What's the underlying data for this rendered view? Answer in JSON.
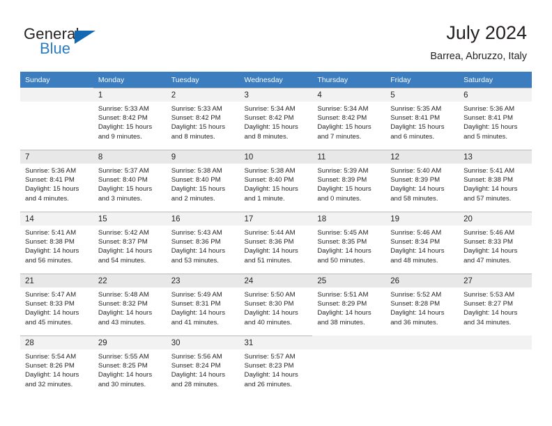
{
  "brand": {
    "name_top": "General",
    "name_bottom": "Blue",
    "triangle_icon": "triangle-icon",
    "accent_color": "#1268b3",
    "blue_text_color": "#2b7cc4"
  },
  "header": {
    "title": "July 2024",
    "subtitle": "Barrea, Abruzzo, Italy"
  },
  "theme": {
    "header_row_bg": "#3b7dbf",
    "header_row_text": "#ffffff",
    "daynum_bg": "#f2f2f2",
    "daynum_bg_alt": "#e8e8e8",
    "border_color": "#b9b9b9",
    "text_color": "#231f20"
  },
  "weekdays": [
    "Sunday",
    "Monday",
    "Tuesday",
    "Wednesday",
    "Thursday",
    "Friday",
    "Saturday"
  ],
  "weeks": [
    [
      {
        "day": "",
        "sunrise": "",
        "sunset": "",
        "daylight1": "",
        "daylight2": ""
      },
      {
        "day": "1",
        "sunrise": "Sunrise: 5:33 AM",
        "sunset": "Sunset: 8:42 PM",
        "daylight1": "Daylight: 15 hours",
        "daylight2": "and 9 minutes."
      },
      {
        "day": "2",
        "sunrise": "Sunrise: 5:33 AM",
        "sunset": "Sunset: 8:42 PM",
        "daylight1": "Daylight: 15 hours",
        "daylight2": "and 8 minutes."
      },
      {
        "day": "3",
        "sunrise": "Sunrise: 5:34 AM",
        "sunset": "Sunset: 8:42 PM",
        "daylight1": "Daylight: 15 hours",
        "daylight2": "and 8 minutes."
      },
      {
        "day": "4",
        "sunrise": "Sunrise: 5:34 AM",
        "sunset": "Sunset: 8:42 PM",
        "daylight1": "Daylight: 15 hours",
        "daylight2": "and 7 minutes."
      },
      {
        "day": "5",
        "sunrise": "Sunrise: 5:35 AM",
        "sunset": "Sunset: 8:41 PM",
        "daylight1": "Daylight: 15 hours",
        "daylight2": "and 6 minutes."
      },
      {
        "day": "6",
        "sunrise": "Sunrise: 5:36 AM",
        "sunset": "Sunset: 8:41 PM",
        "daylight1": "Daylight: 15 hours",
        "daylight2": "and 5 minutes."
      }
    ],
    [
      {
        "day": "7",
        "sunrise": "Sunrise: 5:36 AM",
        "sunset": "Sunset: 8:41 PM",
        "daylight1": "Daylight: 15 hours",
        "daylight2": "and 4 minutes."
      },
      {
        "day": "8",
        "sunrise": "Sunrise: 5:37 AM",
        "sunset": "Sunset: 8:40 PM",
        "daylight1": "Daylight: 15 hours",
        "daylight2": "and 3 minutes."
      },
      {
        "day": "9",
        "sunrise": "Sunrise: 5:38 AM",
        "sunset": "Sunset: 8:40 PM",
        "daylight1": "Daylight: 15 hours",
        "daylight2": "and 2 minutes."
      },
      {
        "day": "10",
        "sunrise": "Sunrise: 5:38 AM",
        "sunset": "Sunset: 8:40 PM",
        "daylight1": "Daylight: 15 hours",
        "daylight2": "and 1 minute."
      },
      {
        "day": "11",
        "sunrise": "Sunrise: 5:39 AM",
        "sunset": "Sunset: 8:39 PM",
        "daylight1": "Daylight: 15 hours",
        "daylight2": "and 0 minutes."
      },
      {
        "day": "12",
        "sunrise": "Sunrise: 5:40 AM",
        "sunset": "Sunset: 8:39 PM",
        "daylight1": "Daylight: 14 hours",
        "daylight2": "and 58 minutes."
      },
      {
        "day": "13",
        "sunrise": "Sunrise: 5:41 AM",
        "sunset": "Sunset: 8:38 PM",
        "daylight1": "Daylight: 14 hours",
        "daylight2": "and 57 minutes."
      }
    ],
    [
      {
        "day": "14",
        "sunrise": "Sunrise: 5:41 AM",
        "sunset": "Sunset: 8:38 PM",
        "daylight1": "Daylight: 14 hours",
        "daylight2": "and 56 minutes."
      },
      {
        "day": "15",
        "sunrise": "Sunrise: 5:42 AM",
        "sunset": "Sunset: 8:37 PM",
        "daylight1": "Daylight: 14 hours",
        "daylight2": "and 54 minutes."
      },
      {
        "day": "16",
        "sunrise": "Sunrise: 5:43 AM",
        "sunset": "Sunset: 8:36 PM",
        "daylight1": "Daylight: 14 hours",
        "daylight2": "and 53 minutes."
      },
      {
        "day": "17",
        "sunrise": "Sunrise: 5:44 AM",
        "sunset": "Sunset: 8:36 PM",
        "daylight1": "Daylight: 14 hours",
        "daylight2": "and 51 minutes."
      },
      {
        "day": "18",
        "sunrise": "Sunrise: 5:45 AM",
        "sunset": "Sunset: 8:35 PM",
        "daylight1": "Daylight: 14 hours",
        "daylight2": "and 50 minutes."
      },
      {
        "day": "19",
        "sunrise": "Sunrise: 5:46 AM",
        "sunset": "Sunset: 8:34 PM",
        "daylight1": "Daylight: 14 hours",
        "daylight2": "and 48 minutes."
      },
      {
        "day": "20",
        "sunrise": "Sunrise: 5:46 AM",
        "sunset": "Sunset: 8:33 PM",
        "daylight1": "Daylight: 14 hours",
        "daylight2": "and 47 minutes."
      }
    ],
    [
      {
        "day": "21",
        "sunrise": "Sunrise: 5:47 AM",
        "sunset": "Sunset: 8:33 PM",
        "daylight1": "Daylight: 14 hours",
        "daylight2": "and 45 minutes."
      },
      {
        "day": "22",
        "sunrise": "Sunrise: 5:48 AM",
        "sunset": "Sunset: 8:32 PM",
        "daylight1": "Daylight: 14 hours",
        "daylight2": "and 43 minutes."
      },
      {
        "day": "23",
        "sunrise": "Sunrise: 5:49 AM",
        "sunset": "Sunset: 8:31 PM",
        "daylight1": "Daylight: 14 hours",
        "daylight2": "and 41 minutes."
      },
      {
        "day": "24",
        "sunrise": "Sunrise: 5:50 AM",
        "sunset": "Sunset: 8:30 PM",
        "daylight1": "Daylight: 14 hours",
        "daylight2": "and 40 minutes."
      },
      {
        "day": "25",
        "sunrise": "Sunrise: 5:51 AM",
        "sunset": "Sunset: 8:29 PM",
        "daylight1": "Daylight: 14 hours",
        "daylight2": "and 38 minutes."
      },
      {
        "day": "26",
        "sunrise": "Sunrise: 5:52 AM",
        "sunset": "Sunset: 8:28 PM",
        "daylight1": "Daylight: 14 hours",
        "daylight2": "and 36 minutes."
      },
      {
        "day": "27",
        "sunrise": "Sunrise: 5:53 AM",
        "sunset": "Sunset: 8:27 PM",
        "daylight1": "Daylight: 14 hours",
        "daylight2": "and 34 minutes."
      }
    ],
    [
      {
        "day": "28",
        "sunrise": "Sunrise: 5:54 AM",
        "sunset": "Sunset: 8:26 PM",
        "daylight1": "Daylight: 14 hours",
        "daylight2": "and 32 minutes."
      },
      {
        "day": "29",
        "sunrise": "Sunrise: 5:55 AM",
        "sunset": "Sunset: 8:25 PM",
        "daylight1": "Daylight: 14 hours",
        "daylight2": "and 30 minutes."
      },
      {
        "day": "30",
        "sunrise": "Sunrise: 5:56 AM",
        "sunset": "Sunset: 8:24 PM",
        "daylight1": "Daylight: 14 hours",
        "daylight2": "and 28 minutes."
      },
      {
        "day": "31",
        "sunrise": "Sunrise: 5:57 AM",
        "sunset": "Sunset: 8:23 PM",
        "daylight1": "Daylight: 14 hours",
        "daylight2": "and 26 minutes."
      },
      {
        "day": "",
        "sunrise": "",
        "sunset": "",
        "daylight1": "",
        "daylight2": ""
      },
      {
        "day": "",
        "sunrise": "",
        "sunset": "",
        "daylight1": "",
        "daylight2": ""
      },
      {
        "day": "",
        "sunrise": "",
        "sunset": "",
        "daylight1": "",
        "daylight2": ""
      }
    ]
  ]
}
